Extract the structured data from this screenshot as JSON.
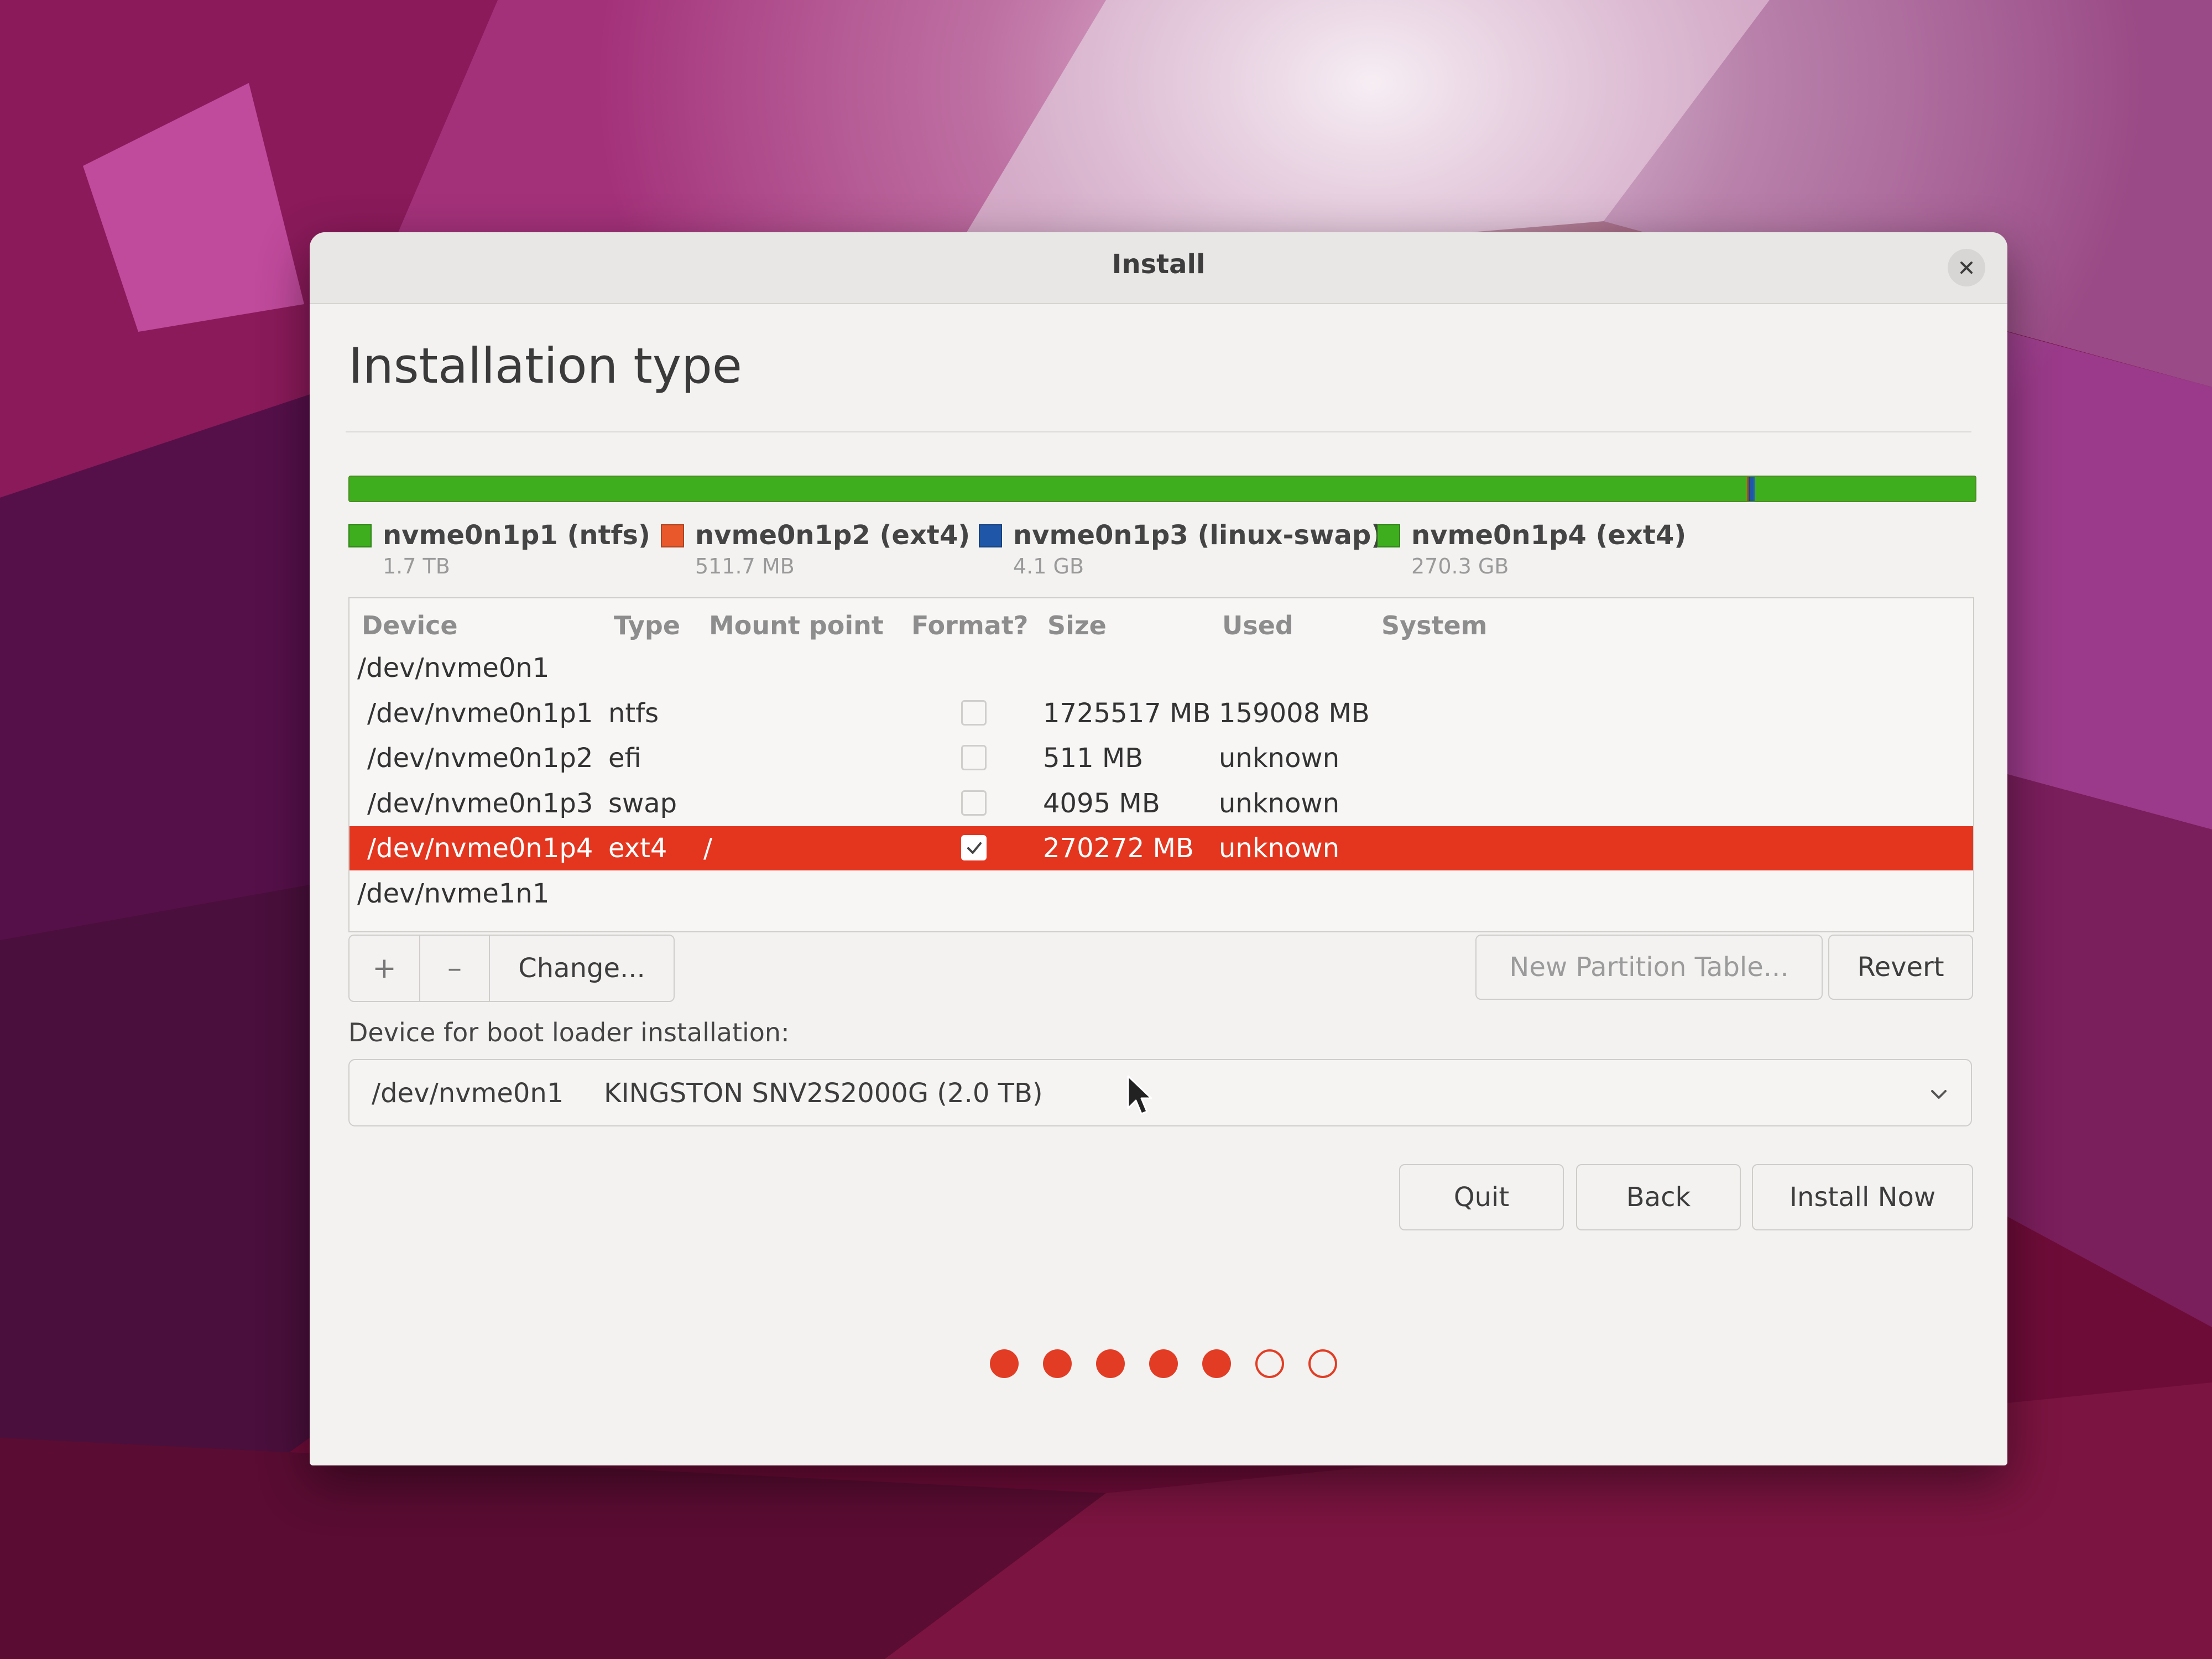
{
  "window": {
    "title": "Install",
    "page_title": "Installation type"
  },
  "icons": {
    "close": "close-icon",
    "chevron": "chevron-down-icon",
    "checkbox_check": "check-icon",
    "cursor": "mouse-pointer-icon"
  },
  "partitions": {
    "legend": [
      {
        "name": "nvme0n1p1 (ntfs)",
        "size": "1.7 TB",
        "color": "#3fae1e"
      },
      {
        "name": "nvme0n1p2 (ext4)",
        "size": "511.7 MB",
        "color": "#e8582a"
      },
      {
        "name": "nvme0n1p3 (linux-swap)",
        "size": "4.1 GB",
        "color": "#1f56a8"
      },
      {
        "name": "nvme0n1p4 (ext4)",
        "size": "270.3 GB",
        "color": "#3fae1e"
      }
    ],
    "bar_fractions": [
      0.862,
      0.0003,
      0.002,
      0.1357
    ]
  },
  "table": {
    "headers": {
      "device": "Device",
      "type": "Type",
      "mount": "Mount point",
      "format": "Format?",
      "size": "Size",
      "used": "Used",
      "system": "System"
    },
    "rows": [
      {
        "device": "/dev/nvme0n1",
        "type": "",
        "mount": "",
        "format": null,
        "size": "",
        "used": "",
        "system": "",
        "is_disk": true,
        "selected": false
      },
      {
        "device": "/dev/nvme0n1p1",
        "type": "ntfs",
        "mount": "",
        "format": false,
        "size": "1725517 MB",
        "used": "159008 MB",
        "system": "",
        "is_disk": false,
        "selected": false
      },
      {
        "device": "/dev/nvme0n1p2",
        "type": "efi",
        "mount": "",
        "format": false,
        "size": "511 MB",
        "used": "unknown",
        "system": "",
        "is_disk": false,
        "selected": false
      },
      {
        "device": "/dev/nvme0n1p3",
        "type": "swap",
        "mount": "",
        "format": false,
        "size": "4095 MB",
        "used": "unknown",
        "system": "",
        "is_disk": false,
        "selected": false
      },
      {
        "device": "/dev/nvme0n1p4",
        "type": "ext4",
        "mount": "/",
        "format": true,
        "size": "270272 MB",
        "used": "unknown",
        "system": "",
        "is_disk": false,
        "selected": true
      },
      {
        "device": "/dev/nvme1n1",
        "type": "",
        "mount": "",
        "format": null,
        "size": "",
        "used": "",
        "system": "",
        "is_disk": true,
        "selected": false
      }
    ]
  },
  "toolbar": {
    "add_label": "+",
    "remove_label": "–",
    "change_label": "Change...",
    "new_table_label": "New Partition Table...",
    "revert_label": "Revert"
  },
  "bootloader": {
    "label": "Device for boot loader installation:",
    "device": "/dev/nvme0n1",
    "model": "KINGSTON SNV2S2000G (2.0 TB)"
  },
  "actions": {
    "quit_label": "Quit",
    "back_label": "Back",
    "install_label": "Install Now"
  },
  "progress": {
    "total_steps": 7,
    "completed_steps": 5,
    "accent": "#e23d24"
  },
  "colors": {
    "selection": "#e4361f",
    "wallpaper_base": "#7a0f40"
  }
}
